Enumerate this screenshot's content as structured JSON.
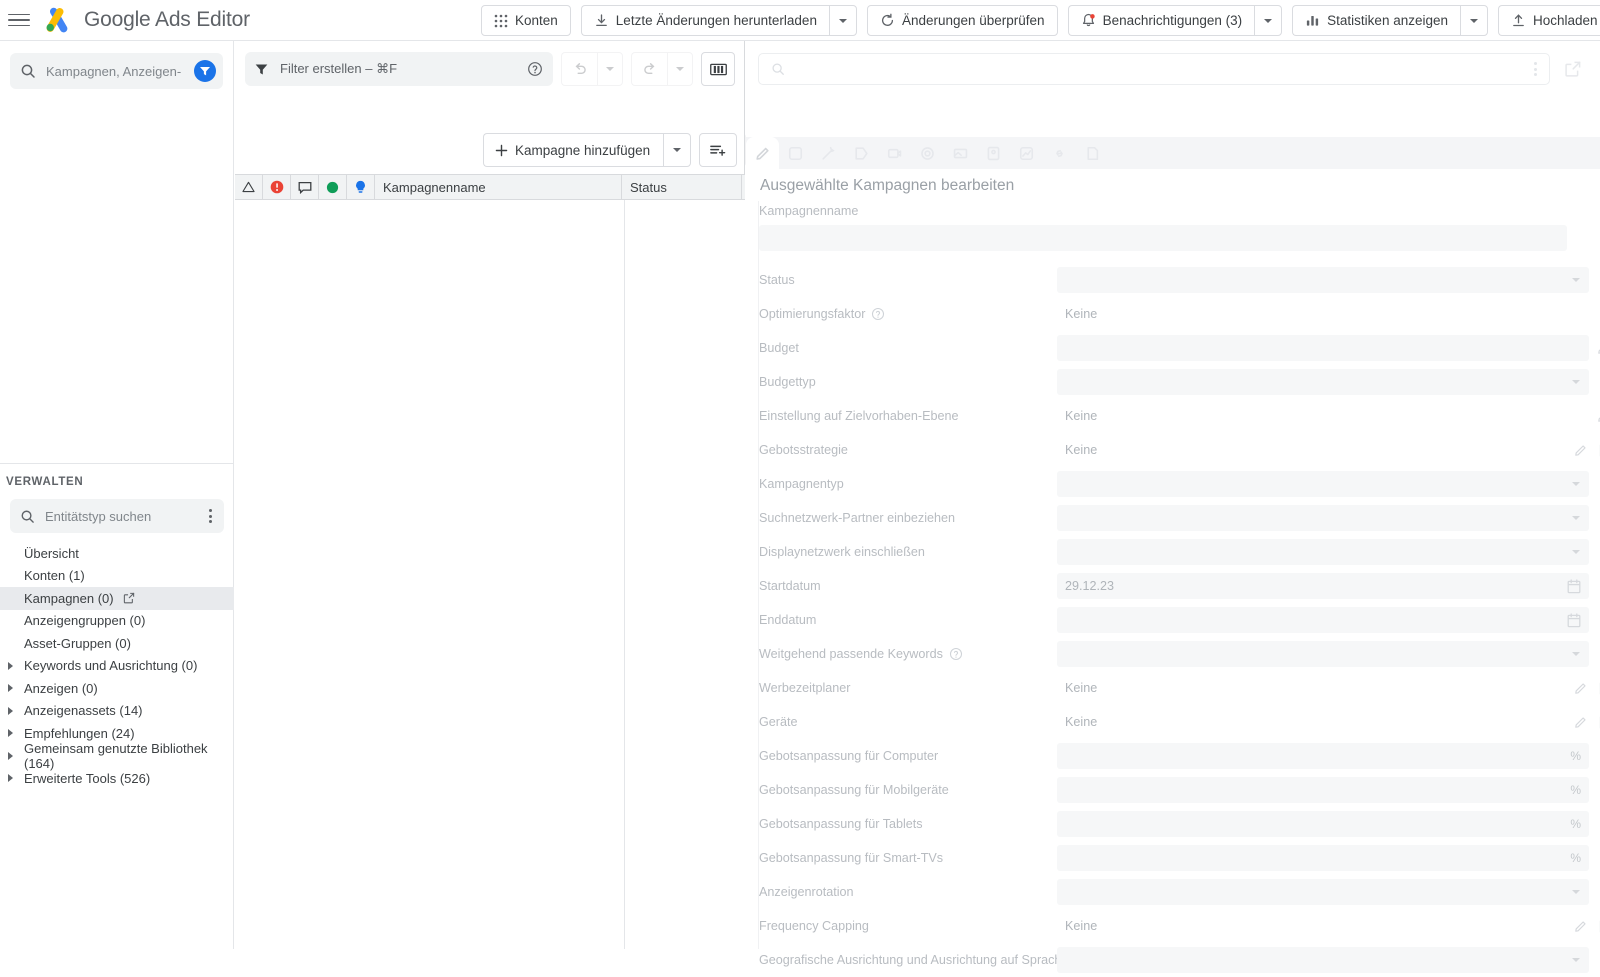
{
  "app": {
    "title": "Google Ads Editor",
    "brand_bold": "Google",
    "brand_rest": " Ads Editor"
  },
  "topbar": {
    "accounts_label": "Konten",
    "download_label": "Letzte Änderungen herunterladen",
    "check_changes_label": "Änderungen überprüfen",
    "notifications_label": "Benachrichtigungen (3)",
    "statistics_label": "Statistiken anzeigen",
    "upload_label": "Hochladen"
  },
  "sidebar": {
    "search_placeholder": "Kampagnen, Anzeigen- oder ...",
    "manage_header": "VERWALTEN",
    "entity_search_placeholder": "Entitätstyp suchen",
    "items": [
      {
        "label": "Übersicht",
        "expandable": false,
        "active": false,
        "external": false
      },
      {
        "label": "Konten (1)",
        "expandable": false,
        "active": false,
        "external": false
      },
      {
        "label": "Kampagnen (0)",
        "expandable": false,
        "active": true,
        "external": true
      },
      {
        "label": "Anzeigengruppen (0)",
        "expandable": false,
        "active": false,
        "external": false
      },
      {
        "label": "Asset-Gruppen (0)",
        "expandable": false,
        "active": false,
        "external": false
      },
      {
        "label": "Keywords und Ausrichtung (0)",
        "expandable": true,
        "active": false,
        "external": false
      },
      {
        "label": "Anzeigen (0)",
        "expandable": true,
        "active": false,
        "external": false
      },
      {
        "label": "Anzeigenassets (14)",
        "expandable": true,
        "active": false,
        "external": false
      },
      {
        "label": "Empfehlungen (24)",
        "expandable": true,
        "active": false,
        "external": false
      },
      {
        "label": "Gemeinsam genutzte Bibliothek (164)",
        "expandable": true,
        "active": false,
        "external": false
      },
      {
        "label": "Erweiterte Tools (526)",
        "expandable": true,
        "active": false,
        "external": false
      }
    ]
  },
  "middle": {
    "filter_placeholder": "Filter erstellen – ⌘F",
    "add_campaign_label": "Kampagne hinzufügen",
    "columns": [
      {
        "label": "Kampagnenname"
      },
      {
        "label": "Status"
      }
    ],
    "status_icons": [
      "warning-triangle-icon",
      "error-circle-icon",
      "comment-icon",
      "green-dot-icon",
      "lightbulb-icon"
    ],
    "rows": []
  },
  "right": {
    "search_value": "",
    "panel_title": "Ausgewählte Kampagnen bearbeiten",
    "tabs": [
      {
        "name": "edit-tab",
        "icon": "pencil-icon",
        "active": true
      },
      {
        "name": "download-tab",
        "icon": "download-icon",
        "active": false
      },
      {
        "name": "magic-tab",
        "icon": "magic-wand-icon",
        "active": false
      },
      {
        "name": "tag-tab",
        "icon": "tag-icon",
        "active": false
      },
      {
        "name": "video-tab",
        "icon": "video-icon",
        "active": false
      },
      {
        "name": "target-tab",
        "icon": "target-icon",
        "active": false
      },
      {
        "name": "image-tab",
        "icon": "image-icon",
        "active": false
      },
      {
        "name": "location-tab",
        "icon": "location-icon",
        "active": false
      },
      {
        "name": "chart-tab",
        "icon": "chart-icon",
        "active": false
      },
      {
        "name": "link-tab",
        "icon": "link-icon",
        "active": false
      },
      {
        "name": "page-tab",
        "icon": "page-icon",
        "active": false
      }
    ],
    "fields": [
      {
        "label": "Kampagnenname",
        "type": "textinput-full",
        "value": ""
      },
      {
        "label": "Status",
        "type": "select",
        "value": ""
      },
      {
        "label": "Optimierungsfaktor",
        "type": "text",
        "value": "Keine",
        "help": true
      },
      {
        "label": "Budget",
        "type": "input-edit",
        "value": ""
      },
      {
        "label": "Budgettyp",
        "type": "select",
        "value": ""
      },
      {
        "label": "Einstellung auf Zielvorhaben-Ebene",
        "type": "text-edit",
        "value": "Keine"
      },
      {
        "label": "Gebotsstrategie",
        "type": "text-edit-copy",
        "value": "Keine"
      },
      {
        "label": "Kampagnentyp",
        "type": "select",
        "value": ""
      },
      {
        "label": "Suchnetzwerk-Partner einbeziehen",
        "type": "select",
        "value": ""
      },
      {
        "label": "Displaynetzwerk einschließen",
        "type": "select",
        "value": ""
      },
      {
        "label": "Startdatum",
        "type": "date",
        "value": "29.12.23"
      },
      {
        "label": "Enddatum",
        "type": "date",
        "value": ""
      },
      {
        "label": "Weitgehend passende Keywords",
        "type": "select",
        "value": "",
        "help": true
      },
      {
        "label": "Werbezeitplaner",
        "type": "text-edit-copy",
        "value": "Keine"
      },
      {
        "label": "Geräte",
        "type": "text-edit-copy",
        "value": "Keine"
      },
      {
        "label": "Gebotsanpassung für Computer",
        "type": "percent",
        "value": ""
      },
      {
        "label": "Gebotsanpassung für Mobilgeräte",
        "type": "percent",
        "value": ""
      },
      {
        "label": "Gebotsanpassung für Tablets",
        "type": "percent",
        "value": ""
      },
      {
        "label": "Gebotsanpassung für Smart-TVs",
        "type": "percent",
        "value": ""
      },
      {
        "label": "Anzeigenrotation",
        "type": "select",
        "value": ""
      },
      {
        "label": "Frequency Capping",
        "type": "text-edit-copy",
        "value": "Keine"
      },
      {
        "label": "Geografische Ausrichtung und Ausrichtung auf Sprachen",
        "type": "select",
        "value": ""
      }
    ]
  },
  "colors": {
    "accent_blue": "#1a73e8",
    "error_red": "#ea4335",
    "green": "#0f9d58",
    "logo_blue": "#4285f4",
    "logo_yellow": "#fbbc04",
    "logo_green": "#34a853"
  }
}
